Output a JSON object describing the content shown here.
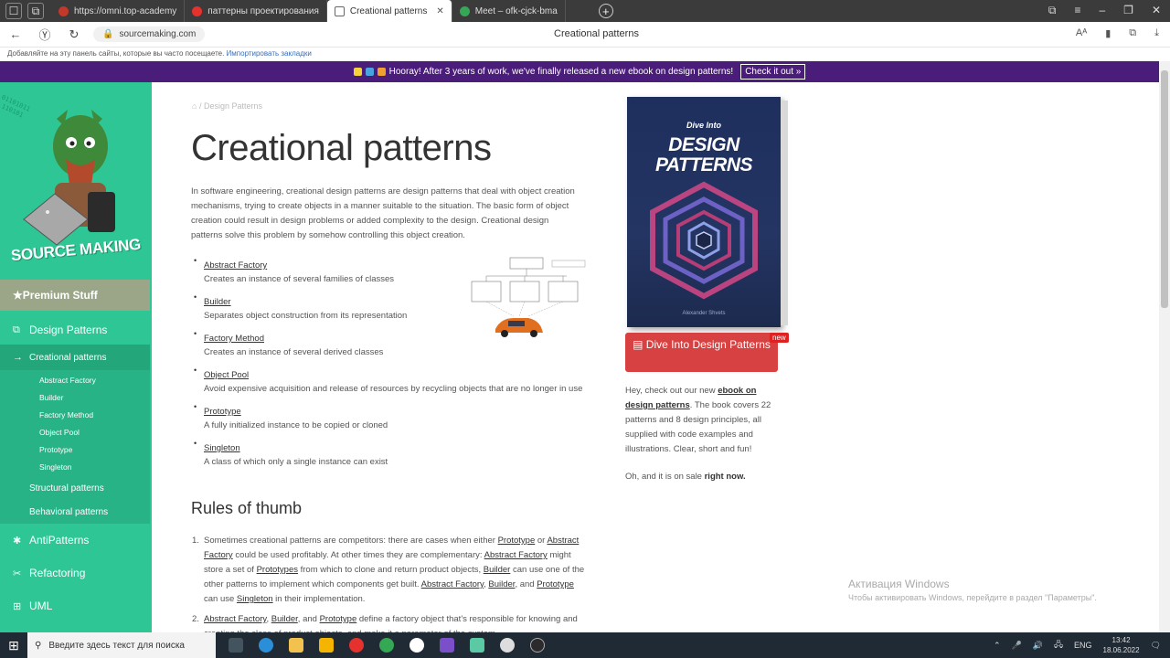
{
  "browser": {
    "tabs": [
      {
        "label": "https://omni.top-academy",
        "color": "#c0392b"
      },
      {
        "label": "паттерны проектирования",
        "color": "#e6322e"
      },
      {
        "label": "Creational patterns",
        "color": "#888888"
      },
      {
        "label": "Meet – ofk-cjck-bma",
        "color": "#34a853"
      }
    ],
    "url": "sourcemaking.com",
    "page_title": "Creational patterns",
    "bookmark_hint": "Добавляйте на эту панель сайты, которые вы часто посещаете.",
    "bookmark_link": "Импортировать закладки"
  },
  "promo": {
    "text": "Hooray! After 3 years of work, we've finally released a new ebook on design patterns!",
    "button": "Check it out »"
  },
  "sidebar": {
    "logo": "SOURCE MAKING",
    "premium": "Premium Stuff",
    "design_patterns": "Design Patterns",
    "creational": "Creational patterns",
    "subitems": [
      "Abstract Factory",
      "Builder",
      "Factory Method",
      "Object Pool",
      "Prototype",
      "Singleton"
    ],
    "structural": "Structural patterns",
    "behavioral": "Behavioral patterns",
    "antipatterns": "AntiPatterns",
    "refactoring": "Refactoring",
    "uml": "UML"
  },
  "main": {
    "breadcrumb": "/ Design Patterns",
    "title": "Creational patterns",
    "intro": "In software engineering, creational design patterns are design patterns that deal with object creation mechanisms, trying to create objects in a manner suitable to the situation. The basic form of object creation could result in design problems or added complexity to the design. Creational design patterns solve this problem by somehow controlling this object creation.",
    "patterns": [
      {
        "name": "Abstract Factory",
        "desc": "Creates an instance of several families of classes"
      },
      {
        "name": "Builder",
        "desc": "Separates object construction from its representation"
      },
      {
        "name": "Factory Method",
        "desc": "Creates an instance of several derived classes"
      },
      {
        "name": "Object Pool",
        "desc": "Avoid expensive acquisition and release of resources by recycling objects that are no longer in use"
      },
      {
        "name": "Prototype",
        "desc": "A fully initialized instance to be copied or cloned"
      },
      {
        "name": "Singleton",
        "desc": "A class of which only a single instance can exist"
      }
    ],
    "rules_title": "Rules of thumb",
    "rule1": {
      "a": "Sometimes creational patterns are competitors: there are cases when either ",
      "b": "Prototype",
      "c": " or ",
      "d": "Abstract Factory",
      "e": " could be used profitably. At other times they are complementary: ",
      "f": "Abstract Factory",
      "g": " might store a set of ",
      "h": "Prototypes",
      "i": " from which to clone and return product objects, ",
      "j": "Builder",
      "k": " can use one of the other patterns to implement which components get built. ",
      "l": "Abstract Factory",
      "m": ", ",
      "n": "Builder",
      "o": ", and ",
      "p": "Prototype",
      "q": " can use ",
      "r": "Singleton",
      "s": " in their implementation."
    },
    "rule2": {
      "a": "Abstract Factory",
      "b": ", ",
      "c": "Builder",
      "d": ", and ",
      "e": "Prototype",
      "f": " define a factory object that's responsible for knowing and creating the class of product objects, and make it a parameter of the system."
    }
  },
  "aside": {
    "book_top": "Dive Into",
    "book_title1": "DESIGN",
    "book_title2": "PATTERNS",
    "book_author": "Alexander Shvets",
    "button": "Dive Into Design Patterns",
    "badge": "new",
    "text_a": "Hey, check out our new ",
    "text_link": "ebook on design patterns",
    "text_b": ". The book covers 22 patterns and 8 design principles, all supplied with code examples and illustrations. Clear, short and fun!",
    "sale_a": "Oh, and it is on sale ",
    "sale_b": "right now."
  },
  "activation": {
    "title": "Активация Windows",
    "sub": "Чтобы активировать Windows, перейдите в раздел \"Параметры\"."
  },
  "taskbar": {
    "search": "Введите здесь текст для поиска",
    "lang": "ENG",
    "time": "13:42",
    "date": "18.06.2022"
  }
}
